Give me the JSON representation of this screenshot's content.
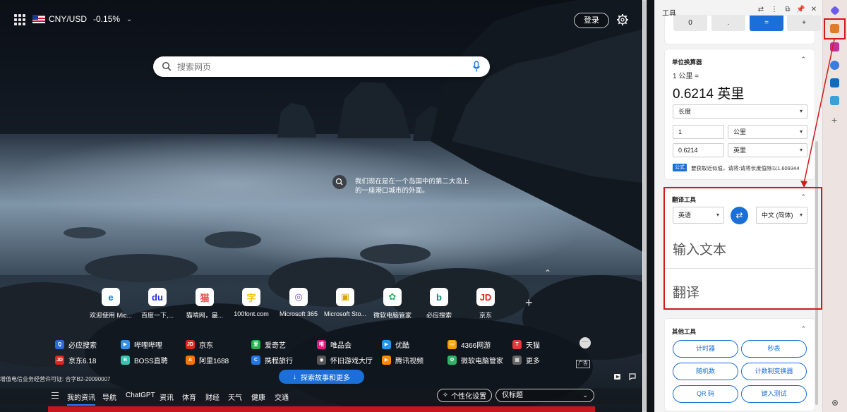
{
  "topbar": {
    "currency_pair": "CNY/USD",
    "currency_change": "-0.15%",
    "login_label": "登录"
  },
  "search": {
    "placeholder": "搜索网页"
  },
  "image_caption": "我们现在是在一个岛国中的第二大岛上的一座港口城市的外面。",
  "tiles": [
    {
      "label": "欢迎使用 Mic...",
      "icon": "edge-icon",
      "color": "#0f7bd8",
      "glyph": "e"
    },
    {
      "label": "百度一下,...",
      "icon": "baidu-paw-icon",
      "color": "#2932e1",
      "glyph": "du"
    },
    {
      "label": "猫啃网，最...",
      "icon": "cat-icon",
      "color": "#e94b3c",
      "glyph": "猫"
    },
    {
      "label": "100font.com",
      "icon": "font-zi-icon",
      "color": "#f2c500",
      "glyph": "字"
    },
    {
      "label": "Microsoft 365",
      "icon": "m365-icon",
      "color": "#7b4fd6",
      "glyph": "◎"
    },
    {
      "label": "Microsoft Sto...",
      "icon": "store-bag-icon",
      "color": "#d9a500",
      "glyph": "▣"
    },
    {
      "label": "微软电脑管家",
      "icon": "pc-manager-icon",
      "color": "#2fb36b",
      "glyph": "✿"
    },
    {
      "label": "必应搜索",
      "icon": "bing-icon",
      "color": "#0f8b7a",
      "glyph": "b"
    },
    {
      "label": "京东",
      "icon": "jd-icon",
      "color": "#e1251b",
      "glyph": "JD"
    }
  ],
  "quick_links_row1": [
    {
      "label": "必应搜索",
      "icon": "search-icon",
      "color": "#2b6bd6",
      "glyph": "Q"
    },
    {
      "label": "哔哩哔哩",
      "icon": "bilibili-icon",
      "color": "#3b8fe0",
      "glyph": "▶"
    },
    {
      "label": "京东",
      "icon": "jd-icon",
      "color": "#e1251b",
      "glyph": "JD"
    },
    {
      "label": "爱奇艺",
      "icon": "iqiyi-icon",
      "color": "#22b14c",
      "glyph": "爱"
    },
    {
      "label": "唯品会",
      "icon": "vip-icon",
      "color": "#e2197e",
      "glyph": "唯"
    },
    {
      "label": "优酷",
      "icon": "youku-icon",
      "color": "#2299e8",
      "glyph": "▶"
    },
    {
      "label": "4366网游",
      "icon": "cat-game-icon",
      "color": "#f2a100",
      "glyph": "🐱"
    },
    {
      "label": "天猫",
      "icon": "tmall-icon",
      "color": "#e4393c",
      "glyph": "T"
    }
  ],
  "quick_links_row2": [
    {
      "label": "京东6.18",
      "icon": "jd-icon",
      "color": "#e1251b",
      "glyph": "JD"
    },
    {
      "label": "BOSS直聘",
      "icon": "boss-icon",
      "color": "#39c2b1",
      "glyph": "B"
    },
    {
      "label": "阿里1688",
      "icon": "ali1688-icon",
      "color": "#ff7300",
      "glyph": "A"
    },
    {
      "label": "携程旅行",
      "icon": "ctrip-icon",
      "color": "#2577e3",
      "glyph": "C"
    },
    {
      "label": "怀旧游戏大厅",
      "icon": "gamepad-icon",
      "color": "#555555",
      "glyph": "◉"
    },
    {
      "label": "腾讯视频",
      "icon": "tencent-video-icon",
      "color": "#ff8a00",
      "glyph": "▶"
    },
    {
      "label": "微软电脑管家",
      "icon": "pc-manager-icon",
      "color": "#2fb36b",
      "glyph": "✿"
    },
    {
      "label": "更多",
      "icon": "grid-more-icon",
      "color": "#666666",
      "glyph": "▦"
    }
  ],
  "ad_label": "广告",
  "icp_text": "增值电信业务经营许可证: 合字B2-20090007",
  "explore_label": "探索故事和更多",
  "news_nav": [
    "我的资讯",
    "导航",
    "ChatGPT",
    "资讯",
    "体育",
    "财经",
    "天气",
    "健康",
    "交通"
  ],
  "personalize_label": "个性化设置",
  "titles_only_label": "仅标题",
  "panel": {
    "title": "工具",
    "calculator_keys": [
      "0",
      ".",
      "=",
      "+"
    ],
    "unit_converter": {
      "title": "单位换算器",
      "expr": "1 公里 =",
      "result": "0.6214 英里",
      "category": "长度",
      "from_value": "1",
      "from_unit": "公里",
      "to_value": "0.6214",
      "to_unit": "英里",
      "formula_badge": "公式",
      "formula_text": "要获取近似值，请将:请将长度值除以1.609344"
    },
    "translator": {
      "title": "翻译工具",
      "source_lang": "英语",
      "target_lang": "中文 (简体)",
      "input_placeholder": "输入文本",
      "output_placeholder": "翻译"
    },
    "other_tools": {
      "title": "其他工具",
      "buttons": [
        "计时器",
        "秒表",
        "随机数",
        "计数制变换器",
        "QR 码",
        "键入测试"
      ]
    }
  },
  "colors": {
    "accent": "#1a6fd8",
    "highlight": "#d31a1a"
  }
}
